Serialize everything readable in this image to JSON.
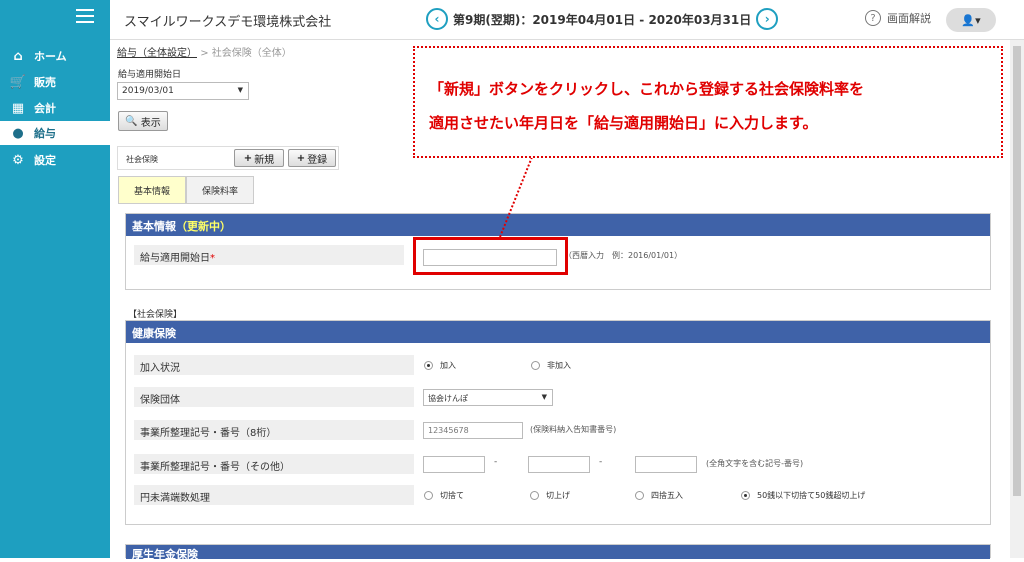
{
  "sidebar": {
    "items": [
      {
        "icon": "home-icon",
        "label": "ホーム"
      },
      {
        "icon": "cart-icon",
        "label": "販売"
      },
      {
        "icon": "calculator-icon",
        "label": "会計"
      },
      {
        "icon": "yen-bag-icon",
        "label": "給与",
        "active": true
      },
      {
        "icon": "gear-icon",
        "label": "設定"
      }
    ]
  },
  "header": {
    "company": "スマイルワークスデモ環境株式会社",
    "period": "第9期(翌期)：2019年04月01日 - 2020年03月31日",
    "help_label": "画面解説"
  },
  "breadcrumb": {
    "root": "給与（全体設定）",
    "sep": ">",
    "current": "社会保険（全体）"
  },
  "filter": {
    "label": "給与適用開始日",
    "date_value": "2019/03/01",
    "show_button": "表示"
  },
  "section": {
    "label": "社会保険",
    "new_button": "新規",
    "register_button": "登録"
  },
  "tabs": [
    "基本情報",
    "保険料率"
  ],
  "basic": {
    "title": "基本情報",
    "status": "（更新中）",
    "start_date_label": "給与適用開始日",
    "required_mark": "*",
    "start_date_hint": "（西暦入力　例：2016/01/01）"
  },
  "social_label": "【社会保険】",
  "health": {
    "title": "健康保険",
    "join_label": "加入状況",
    "join_options": [
      "加入",
      "非加入"
    ],
    "group_label": "保険団体",
    "group_value": "協会けんぽ",
    "office_no_label": "事業所整理記号・番号（8桁）",
    "office_no_value": "12345678",
    "office_no_hint": "(保険料納入告知書番号)",
    "office_other_label": "事業所整理記号・番号（その他）",
    "dash": "-",
    "office_other_hint": "(全角文字を含む記号-番号)",
    "rounding_label": "円未満端数処理",
    "rounding_options": [
      "切捨て",
      "切上げ",
      "四捨五入",
      "50銭以下切捨て50銭超切上げ"
    ]
  },
  "pension": {
    "title": "厚生年金保険"
  },
  "callout": {
    "line1": "「新規」ボタンをクリックし、これから登録する社会保険料率を",
    "line2": "適用させたい年月日を「給与適用開始日」に入力します。"
  },
  "colors": {
    "sidebar": "#1e9fc0",
    "panel_header": "#3f62a8",
    "callout": "#e00000"
  }
}
